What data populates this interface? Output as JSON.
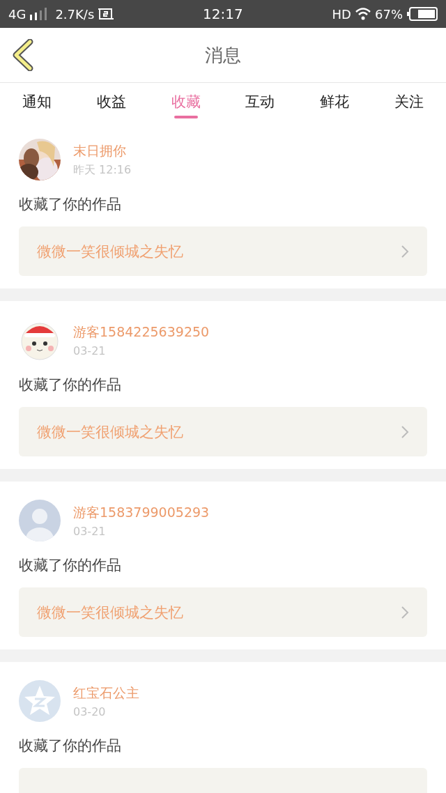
{
  "status_bar": {
    "network": "4G",
    "speed": "2.7K/s",
    "time": "12:17",
    "hd": "HD",
    "battery": "67%"
  },
  "header": {
    "title": "消息"
  },
  "tabs": [
    {
      "label": "通知",
      "selected": false
    },
    {
      "label": "收益",
      "selected": false
    },
    {
      "label": "收藏",
      "selected": true
    },
    {
      "label": "互动",
      "selected": false
    },
    {
      "label": "鲜花",
      "selected": false
    },
    {
      "label": "关注",
      "selected": false
    }
  ],
  "messages": [
    {
      "kind": "picture",
      "name": "末日拥你",
      "time": "昨天 12:16",
      "action": "收藏了你的作品",
      "work": "微微一笑很倾城之失忆"
    },
    {
      "kind": "cartoon",
      "name": "游客1584225639250",
      "time": "03-21",
      "action": "收藏了你的作品",
      "work": "微微一笑很倾城之失忆"
    },
    {
      "kind": "person",
      "name": "游客1583799005293",
      "time": "03-21",
      "action": "收藏了你的作品",
      "work": "微微一笑很倾城之失忆"
    },
    {
      "kind": "star",
      "name": "红宝石公主",
      "time": "03-20",
      "action": "收藏了你的作品"
    }
  ]
}
